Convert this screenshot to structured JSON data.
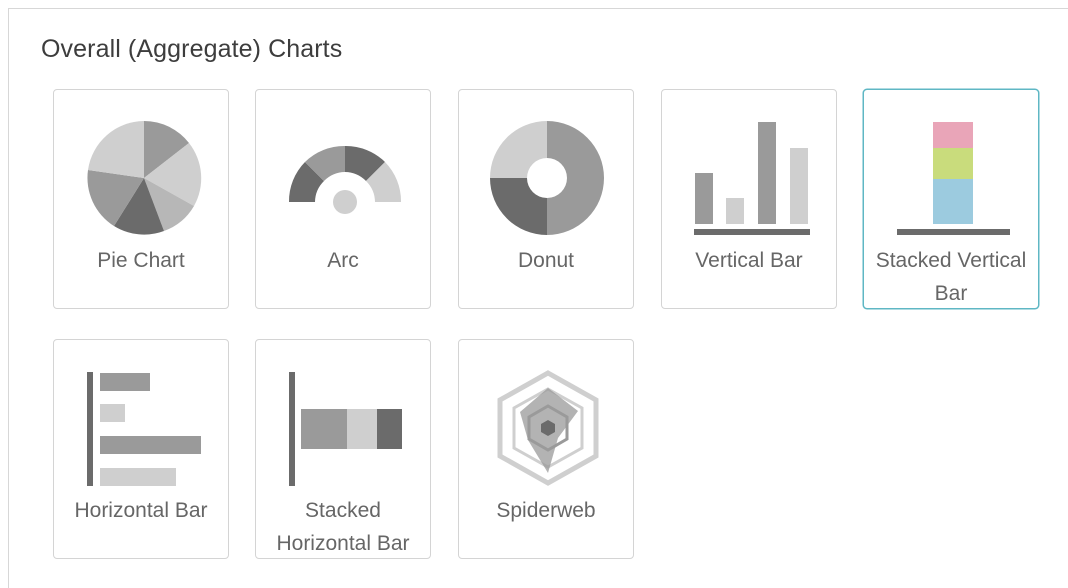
{
  "section": {
    "title": "Overall (Aggregate) Charts"
  },
  "chart_types": [
    {
      "label": "Pie Chart",
      "icon": "pie-chart-icon",
      "selected": false
    },
    {
      "label": "Arc",
      "icon": "arc-chart-icon",
      "selected": false
    },
    {
      "label": "Donut",
      "icon": "donut-chart-icon",
      "selected": false
    },
    {
      "label": "Vertical Bar",
      "icon": "vertical-bar-chart-icon",
      "selected": false
    },
    {
      "label": "Stacked Vertical Bar",
      "icon": "stacked-vertical-bar-chart-icon",
      "selected": true
    },
    {
      "label": "Horizontal Bar",
      "icon": "horizontal-bar-chart-icon",
      "selected": false
    },
    {
      "label": "Stacked Horizontal Bar",
      "icon": "stacked-horizontal-bar-chart-icon",
      "selected": false
    },
    {
      "label": "Spiderweb",
      "icon": "spiderweb-chart-icon",
      "selected": false
    }
  ],
  "colors": {
    "selected_border": "#5fb7c4",
    "tile_border": "#d4d4d4",
    "label_text": "#666666",
    "title_text": "#3d3d3d",
    "icon_dark": "#6b6b6b",
    "icon_mid": "#9a9a9a",
    "icon_light": "#cfcfcf",
    "stack_pink": "#e9a5b8",
    "stack_green": "#c9dc7c",
    "stack_blue": "#9ccbdf"
  }
}
